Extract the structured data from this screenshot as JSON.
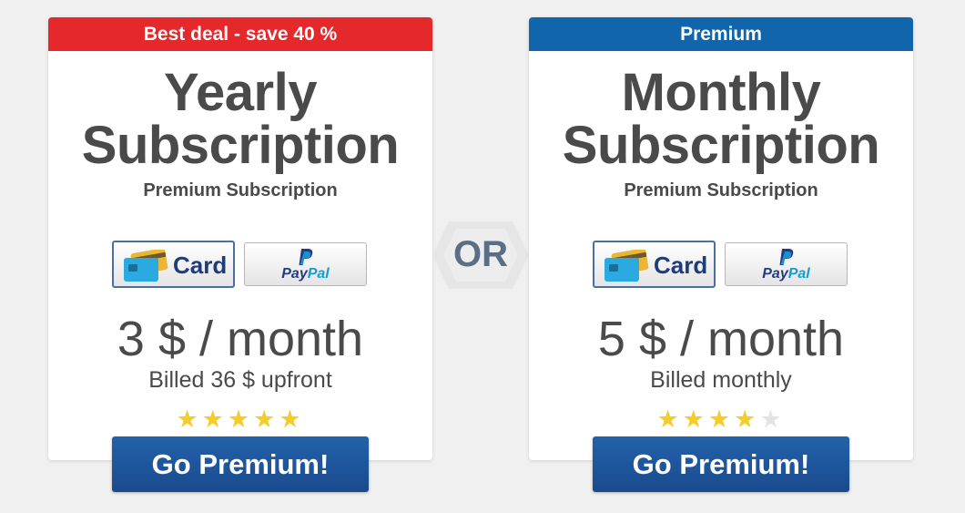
{
  "colors": {
    "ribbon_yearly": "#e5282b",
    "ribbon_monthly": "#1166ab",
    "button_blue": "#1f56a0",
    "text_gray": "#4a4a4a",
    "star_on": "#f6cc2c",
    "star_off": "#e3e3e3"
  },
  "or_label": "OR",
  "plans": [
    {
      "ribbon": "Best deal - save 40 %",
      "title_line1": "Yearly",
      "title_line2": "Subscription",
      "subtitle": "Premium Subscription",
      "card_label": "Card",
      "paypal_label_part1": "Pay",
      "paypal_label_part2": "Pal",
      "price": "3 $ / month",
      "billing": "Billed 36 $ upfront",
      "rating": 5,
      "cta": "Go Premium!"
    },
    {
      "ribbon": "Premium",
      "title_line1": "Monthly",
      "title_line2": "Subscription",
      "subtitle": "Premium Subscription",
      "card_label": "Card",
      "paypal_label_part1": "Pay",
      "paypal_label_part2": "Pal",
      "price": "5 $ / month",
      "billing": "Billed monthly",
      "rating": 4,
      "cta": "Go Premium!"
    }
  ]
}
